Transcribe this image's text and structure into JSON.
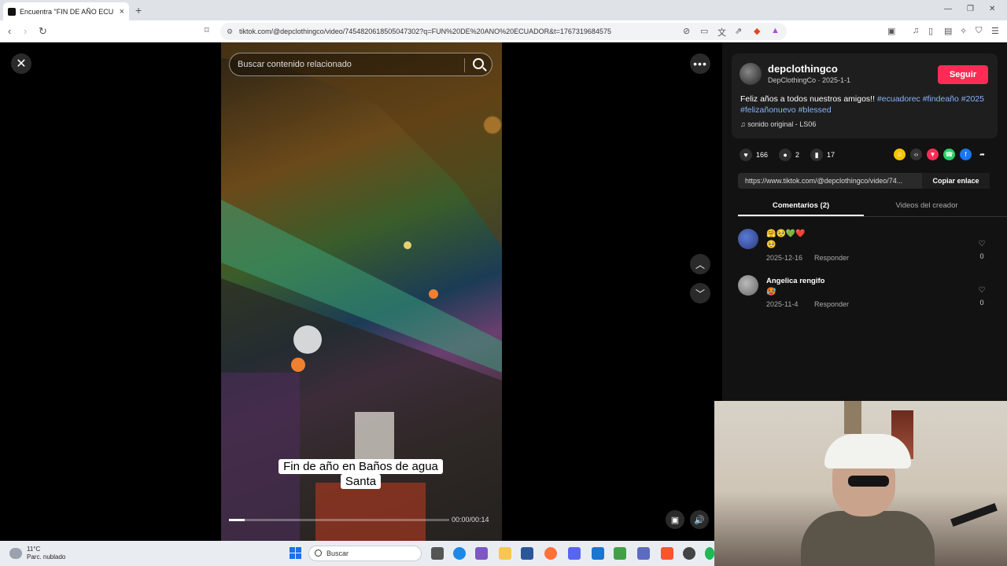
{
  "browser": {
    "tab_title": "Encuentra \"FIN DE AÑO ECU",
    "tab_close": "×",
    "new_tab": "+",
    "url": "tiktok.com/@depclothingco/video/7454820618505047302?q=FUN%20DE%20ANO%20ECUADOR&t=1767319684575"
  },
  "video": {
    "search_placeholder": "Buscar contenido relacionado",
    "caption_line1": "Fin de año en Baños de agua",
    "caption_line2": "Santa",
    "time": "00:00/00:14",
    "progress_fraction": 0.07
  },
  "post": {
    "username": "depclothingco",
    "meta": "DepClothingCo · 2025-1-1",
    "follow_label": "Seguir",
    "description_text": "Feliz años a todos nuestros amigos!! ",
    "hashtags": [
      "#ecuadorec",
      "#findeaño",
      "#2025",
      "#felizañonuevo",
      "#blessed"
    ],
    "sound": "sonido original - LS06",
    "likes": "166",
    "comments_count": "2",
    "saves": "17",
    "link": "https://www.tiktok.com/@depclothingco/video/74...",
    "copy_label": "Copiar enlace",
    "tab_comments": "Comentarios (2)",
    "tab_creator": "Videos del creador"
  },
  "comments": [
    {
      "author": "",
      "text": "🤗🥺💚❤️\n🥺",
      "date": "2025-12-16",
      "reply": "Responder",
      "likes": "0"
    },
    {
      "author": "Angelica rengifo",
      "text": "🥵",
      "date": "2025-11-4",
      "reply": "Responder",
      "likes": "0"
    }
  ],
  "taskbar": {
    "temp": "11°C",
    "weather": "Parc. nublado",
    "search": "Buscar"
  }
}
